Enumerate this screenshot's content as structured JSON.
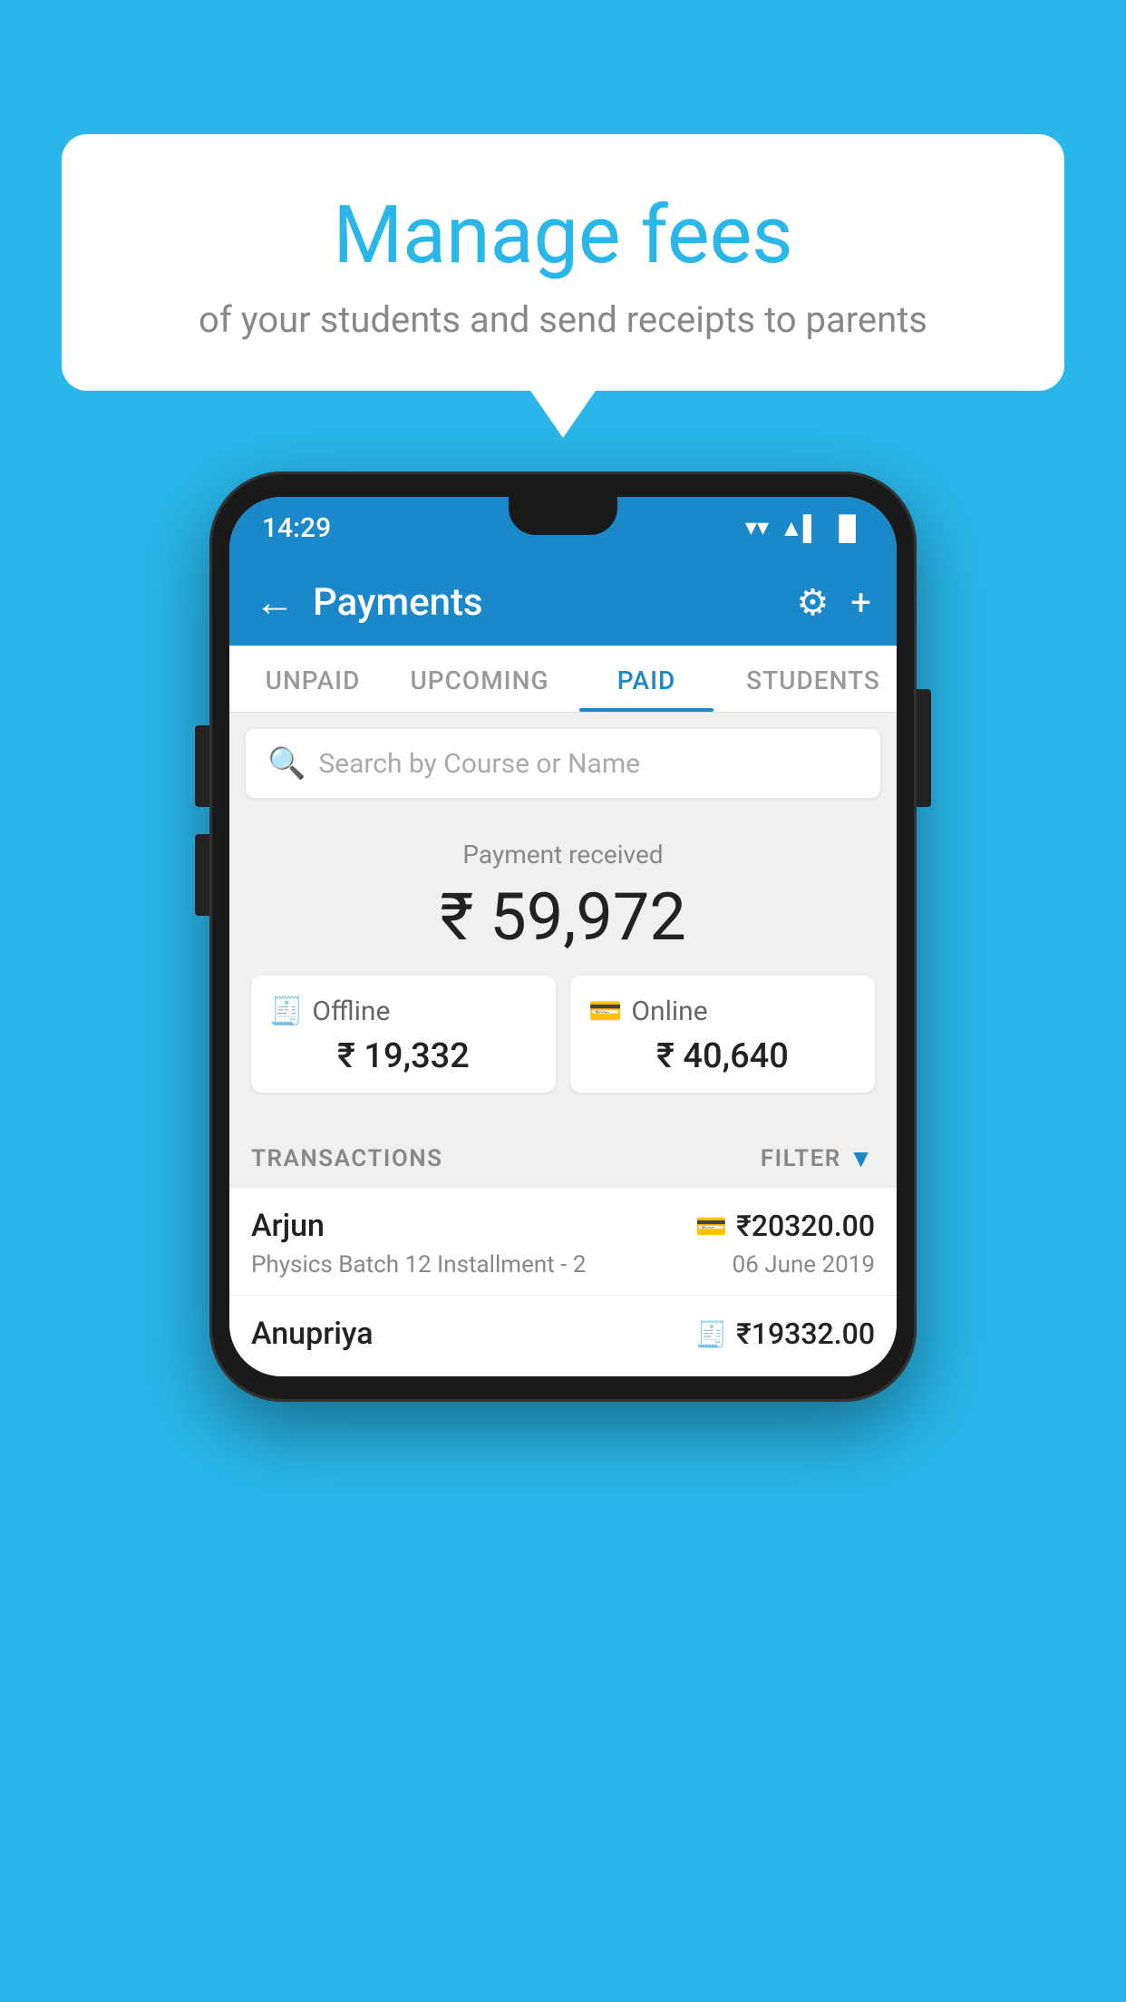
{
  "background_color": "#29b6e8",
  "bubble": {
    "title": "Manage fees",
    "subtitle": "of your students and send receipts to parents"
  },
  "status_bar": {
    "time": "14:29",
    "wifi_icon": "▼",
    "signal_icon": "▲▌",
    "battery_icon": "▐"
  },
  "app_bar": {
    "back_label": "←",
    "title": "Payments",
    "gear_label": "⚙",
    "plus_label": "+"
  },
  "tabs": [
    {
      "label": "UNPAID",
      "active": false
    },
    {
      "label": "UPCOMING",
      "active": false
    },
    {
      "label": "PAID",
      "active": true
    },
    {
      "label": "STUDENTS",
      "active": false
    }
  ],
  "search": {
    "placeholder": "Search by Course or Name"
  },
  "payment_summary": {
    "label": "Payment received",
    "amount": "₹ 59,972",
    "offline": {
      "icon": "🧾",
      "type": "Offline",
      "amount": "₹ 19,332"
    },
    "online": {
      "icon": "💳",
      "type": "Online",
      "amount": "₹ 40,640"
    }
  },
  "transactions_section": {
    "label": "TRANSACTIONS",
    "filter_label": "FILTER"
  },
  "transactions": [
    {
      "name": "Arjun",
      "mode_icon": "💳",
      "amount": "₹20320.00",
      "course": "Physics Batch 12 Installment - 2",
      "date": "06 June 2019"
    },
    {
      "name": "Anupriya",
      "mode_icon": "🧾",
      "amount": "₹19332.00",
      "course": "",
      "date": ""
    }
  ]
}
